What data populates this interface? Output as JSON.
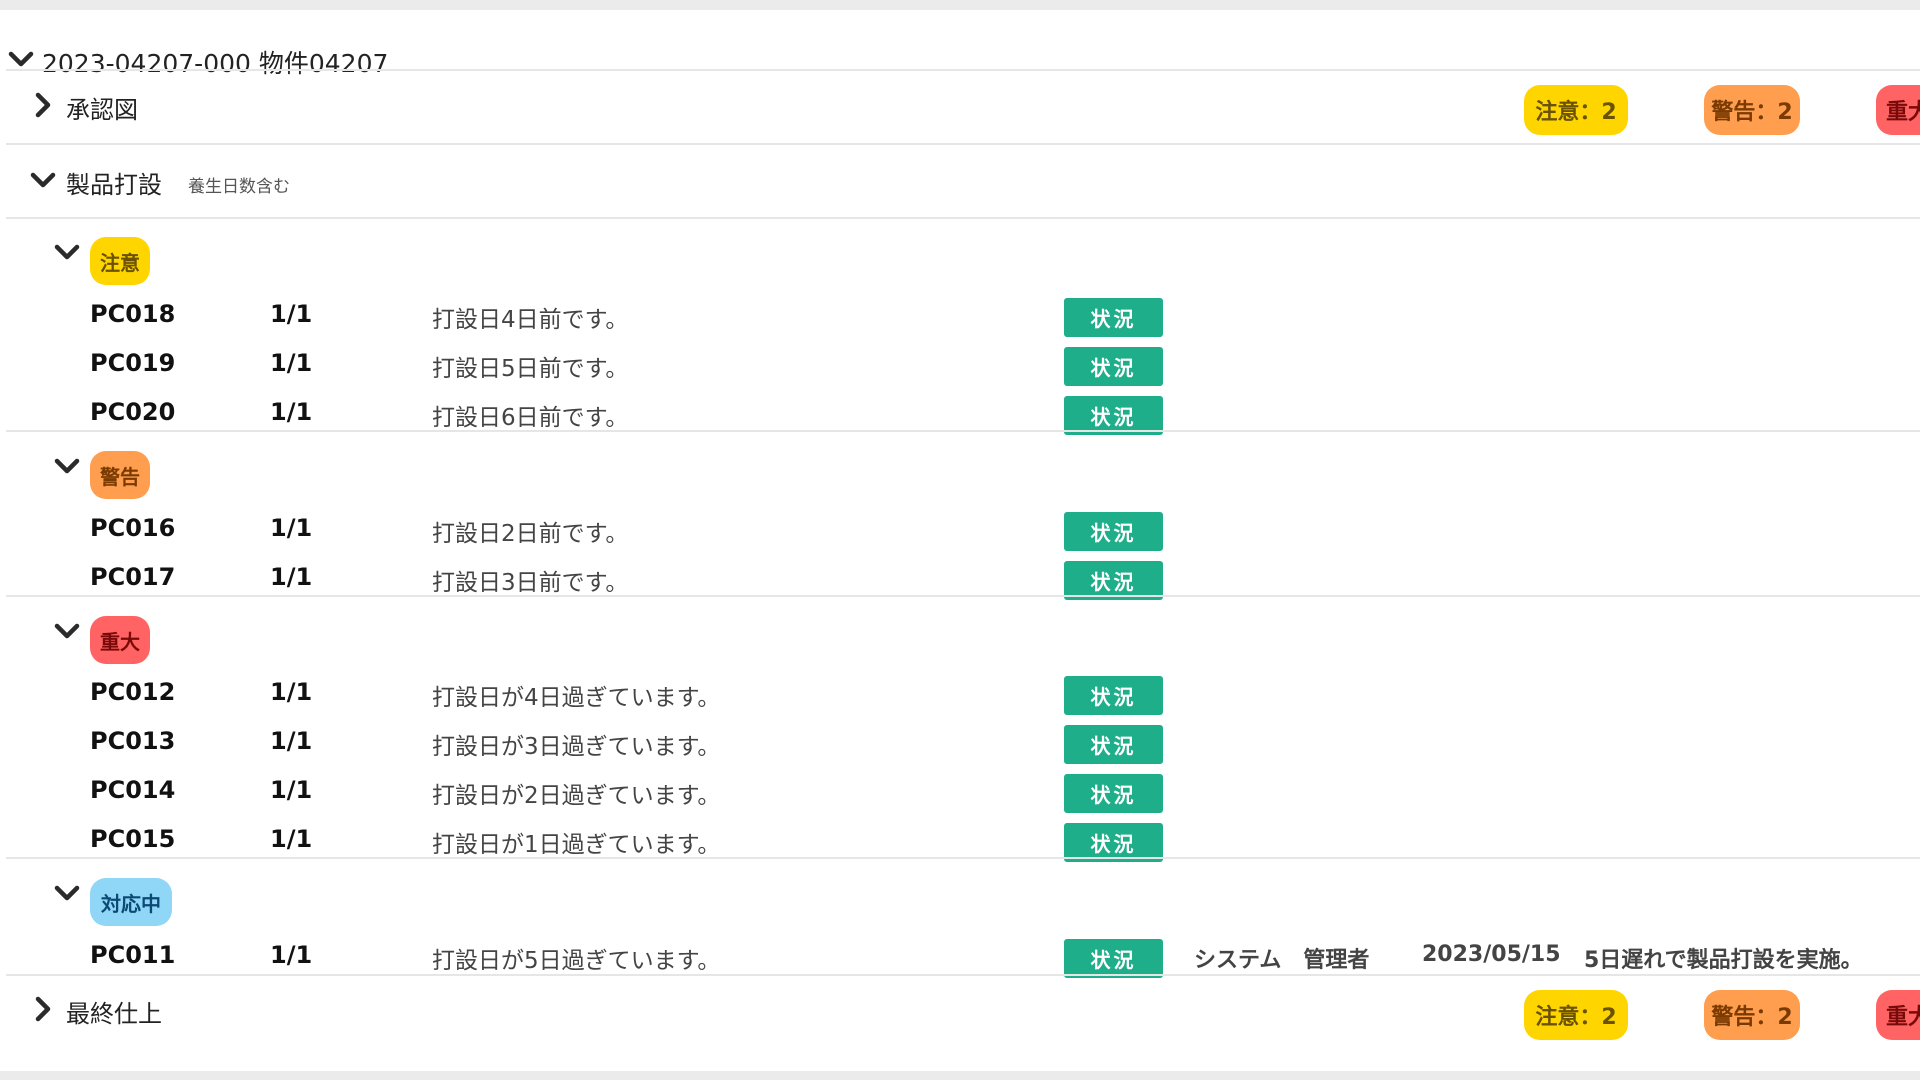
{
  "project": {
    "title": "2023-04207-000 物件04207"
  },
  "colors": {
    "notice": "#ffd500",
    "notice_text": "#6a5200",
    "warning": "#ff9e4f",
    "warning_text": "#7a3a00",
    "critical": "#ff6363",
    "critical_text": "#7a0a0a",
    "inprogress": "#8fd6f7",
    "inprogress_text": "#0c4a75",
    "status_button": "#1fae8a"
  },
  "sections": {
    "approval": {
      "label": "承認図",
      "badges": {
        "notice": "注意：2",
        "warning": "警告：2",
        "critical": "重大"
      }
    },
    "product": {
      "label": "製品打設",
      "note": "養生日数含む"
    },
    "final": {
      "label": "最終仕上",
      "badges": {
        "notice": "注意：2",
        "warning": "警告：2",
        "critical": "重大"
      }
    }
  },
  "groups": {
    "notice": {
      "label": "注意",
      "rows": [
        {
          "code": "PC018",
          "qty": "1/1",
          "message": "打設日4日前です。",
          "button": "状況"
        },
        {
          "code": "PC019",
          "qty": "1/1",
          "message": "打設日5日前です。",
          "button": "状況"
        },
        {
          "code": "PC020",
          "qty": "1/1",
          "message": "打設日6日前です。",
          "button": "状況"
        }
      ]
    },
    "warning": {
      "label": "警告",
      "rows": [
        {
          "code": "PC016",
          "qty": "1/1",
          "message": "打設日2日前です。",
          "button": "状況"
        },
        {
          "code": "PC017",
          "qty": "1/1",
          "message": "打設日3日前です。",
          "button": "状況"
        }
      ]
    },
    "critical": {
      "label": "重大",
      "rows": [
        {
          "code": "PC012",
          "qty": "1/1",
          "message": "打設日が4日過ぎています。",
          "button": "状況"
        },
        {
          "code": "PC013",
          "qty": "1/1",
          "message": "打設日が3日過ぎています。",
          "button": "状況"
        },
        {
          "code": "PC014",
          "qty": "1/1",
          "message": "打設日が2日過ぎています。",
          "button": "状況"
        },
        {
          "code": "PC015",
          "qty": "1/1",
          "message": "打設日が1日過ぎています。",
          "button": "状況"
        }
      ]
    },
    "inprogress": {
      "label": "対応中",
      "rows": [
        {
          "code": "PC011",
          "qty": "1/1",
          "message": "打設日が5日過ぎています。",
          "button": "状況",
          "handler": "システム　管理者",
          "date": "2023/05/15",
          "note": "5日遅れで製品打設を実施。"
        }
      ]
    }
  }
}
